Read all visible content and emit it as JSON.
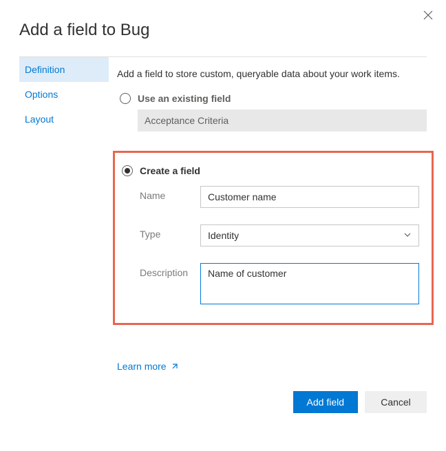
{
  "dialog": {
    "title": "Add a field to Bug"
  },
  "sidebar": {
    "items": [
      {
        "label": "Definition"
      },
      {
        "label": "Options"
      },
      {
        "label": "Layout"
      }
    ]
  },
  "main": {
    "intro": "Add a field to store custom, queryable data about your work items.",
    "existing_option_label": "Use an existing field",
    "existing_field_value": "Acceptance Criteria",
    "create_option_label": "Create a field",
    "name_label": "Name",
    "name_value": "Customer name",
    "type_label": "Type",
    "type_value": "Identity",
    "description_label": "Description",
    "description_value": "Name of customer",
    "learn_more": "Learn more"
  },
  "footer": {
    "primary": "Add field",
    "secondary": "Cancel"
  }
}
